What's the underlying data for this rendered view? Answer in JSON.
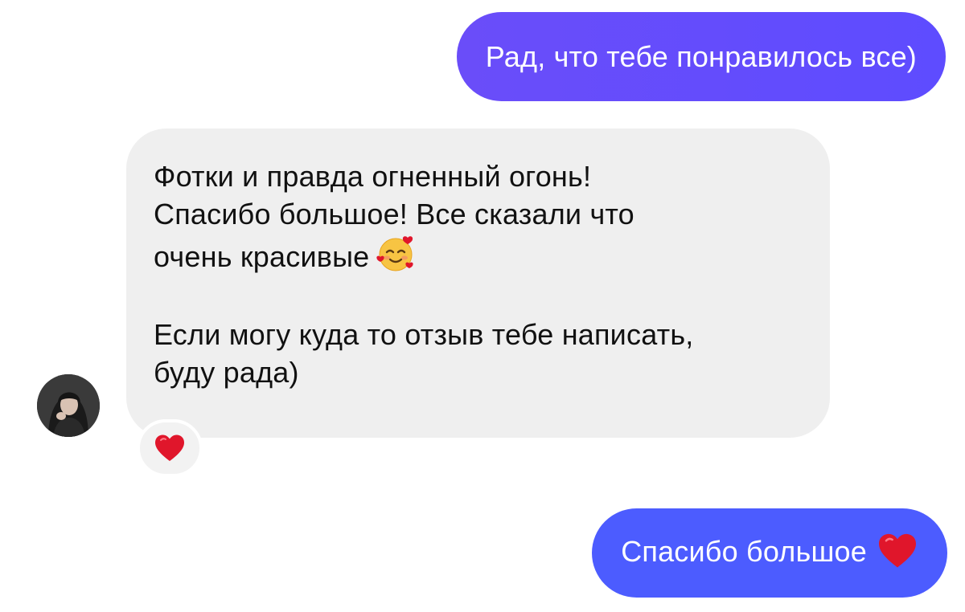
{
  "messages": {
    "outgoing_1": {
      "text": "Рад, что тебе понравилось все)"
    },
    "incoming_1": {
      "lines": [
        "Фотки и правда огненный огонь!",
        "Спасибо большое! Все сказали что",
        "очень красивые",
        "Если могу куда то отзыв тебе написать,",
        "буду рада)"
      ],
      "emoji": "smiling-face-with-hearts-icon",
      "reaction": "red-heart-icon"
    },
    "outgoing_2": {
      "text": "Спасибо большое",
      "emoji": "red-heart-icon"
    }
  },
  "colors": {
    "outgoing_1_bubble": "#5e4cff",
    "outgoing_2_bubble": "#4c5cff",
    "incoming_bubble": "#efefef",
    "heart": "#e0162b"
  }
}
